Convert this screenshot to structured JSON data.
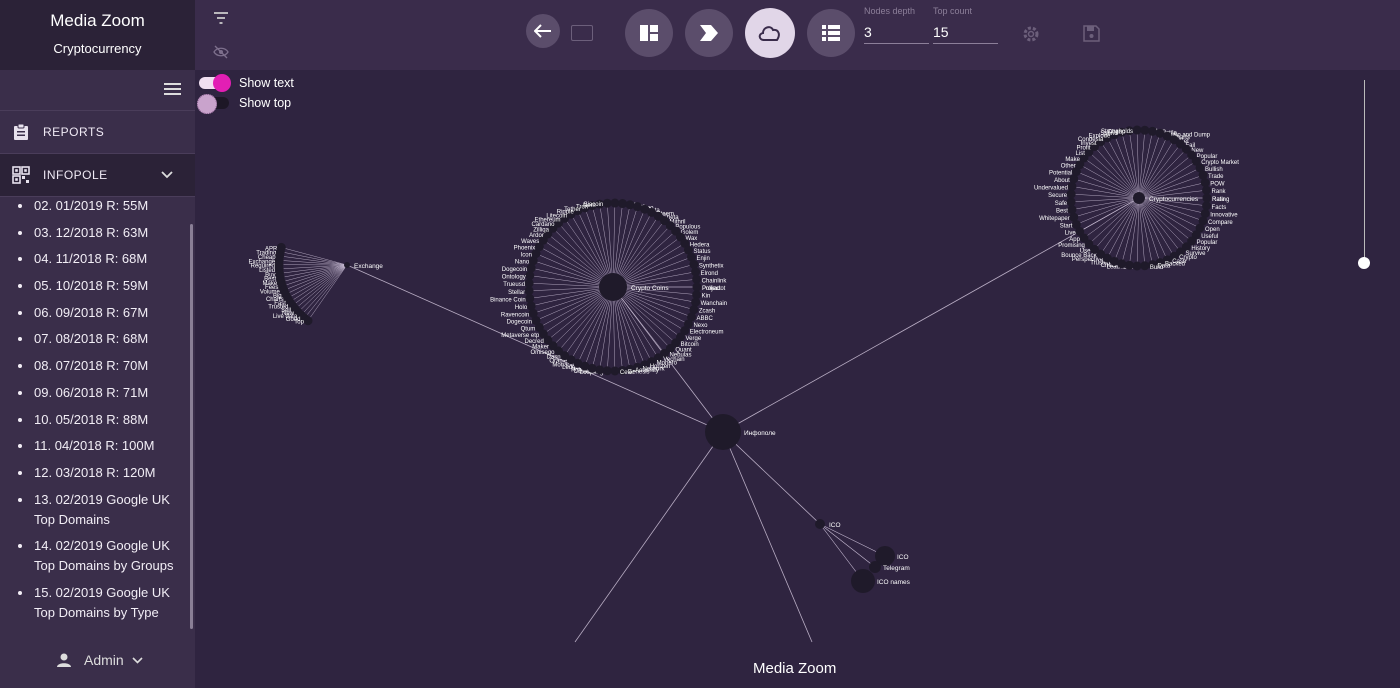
{
  "app": {
    "title": "Media Zoom",
    "subtitle": "Cryptocurrency"
  },
  "nav": {
    "reports": "REPORTS",
    "infopole": "INFOPOLE"
  },
  "reports_list": [
    "02. 01/2019 R: 55M",
    "03. 12/2018 R: 63M",
    "04. 11/2018 R: 68M",
    "05. 10/2018 R: 59M",
    "06. 09/2018 R: 67M",
    "07. 08/2018 R: 68M",
    "08. 07/2018 R: 70M",
    "09. 06/2018 R: 71M",
    "10. 05/2018 R: 88M",
    "11. 04/2018 R: 100M",
    "12. 03/2018 R: 120M",
    "13. 02/2019 Google UK Top Domains",
    "14. 02/2019 Google UK Top Domains by Groups",
    "15. 02/2019 Google UK Top Domains by Type"
  ],
  "user": {
    "name": "Admin"
  },
  "toolbar": {
    "nodes_depth_label": "Nodes depth",
    "nodes_depth": "3",
    "top_count_label": "Top count",
    "top_count": "15"
  },
  "toggles": {
    "show_text": "Show text",
    "show_top": "Show top",
    "show_text_on": true,
    "show_top_on": false
  },
  "graph": {
    "center": "Инфополе",
    "hubs": {
      "exchange": "Exchange",
      "crypto_coins": "Crypto Coins",
      "cryptocurrencies": "Cryptocurrencies",
      "ico": "ICO"
    },
    "exchange_leaves": [
      "APR",
      "Trading",
      "Cheap",
      "Exchange",
      "Required",
      "Listed",
      "Buy",
      "Best",
      "Make",
      "Fees",
      "Volume",
      "Big",
      "Charts",
      "Fast",
      "Trusted",
      "Sell",
      "New",
      "Live data",
      "Good",
      "Top"
    ],
    "crypto_coins_leaves": [
      "Project",
      "Kin",
      "Wanchain",
      "Zcash",
      "ABBC",
      "Nexo",
      "Electroneum",
      "Verge",
      "Bitcoin",
      "Quant",
      "Nebulas",
      "Vechain",
      "Monero",
      "Horizen",
      "Network",
      "Aeternity",
      "Genesis",
      "Celer",
      "Loopring",
      "Cosmos",
      "Power",
      "Ledger",
      "Monaco",
      "Oracle",
      "Dash",
      "Omisego",
      "Maker",
      "Decred",
      "Metaverse etp",
      "Qtum",
      "Dogecoin",
      "Ravencoin",
      "Holo",
      "Binance Coin",
      "Stellar",
      "Trueusd",
      "Ontology",
      "Dogecoin",
      "Nano",
      "Icon",
      "Phoenix",
      "Waves",
      "Ardor",
      "Zilliqa",
      "Cardano",
      "Ethereum",
      "Litecoin",
      "Ripple",
      "Tether",
      "Tron",
      "Nem",
      "Siacoin",
      "Augur",
      "Gas",
      "Eos",
      "Neo",
      "Iota",
      "Steem",
      "Theta",
      "Mithril",
      "Populous",
      "Golem",
      "Wax",
      "Hedera",
      "Status",
      "Enjin",
      "Synthetix",
      "Elrond",
      "Chainlink",
      "Polkadot"
    ],
    "cryptocurrencies_leaves": [
      "Rating",
      "Facts",
      "Innovative",
      "Compare",
      "Open",
      "Useful",
      "Popular",
      "History",
      "Survive",
      "Crypto",
      "Cash",
      "Backed",
      "Data",
      "Build",
      "Sell",
      "Leader",
      "Check",
      "Trusted",
      "Perspective",
      "Bounce Back",
      "Use",
      "Promising",
      "App",
      "Live",
      "Start",
      "Whitepaper",
      "Best",
      "Safe",
      "Secure",
      "Undervalued",
      "About",
      "Potential",
      "Other",
      "Make",
      "List",
      "Profit",
      "Invest",
      "Condesia",
      "Explode",
      "Spend",
      "Cheap",
      "Strongholds",
      "Token",
      "Volatile",
      "Pump and Dump",
      "Charts",
      "Get",
      "Fail",
      "New",
      "Popular",
      "Crypto Market",
      "Bullish",
      "Trade",
      "POW",
      "Rank",
      "Rate"
    ],
    "ico_leaves": [
      "ICO",
      "Telegram",
      "ICO names"
    ]
  },
  "colors": {
    "accent": "#e21fb4",
    "background": "#2f2440",
    "sidebar": "#3a2e4a",
    "node": "#1f1a2a"
  },
  "footer": "Media Zoom"
}
